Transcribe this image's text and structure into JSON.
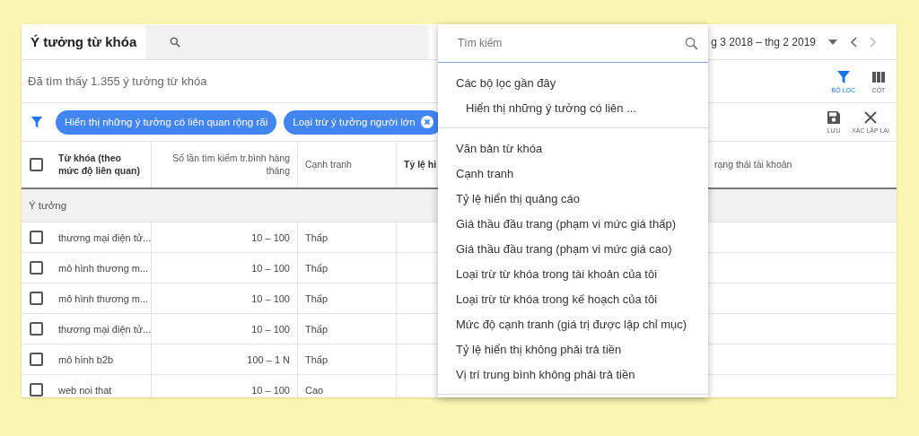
{
  "header": {
    "title": "Ý tưởng từ khóa",
    "date_range": "g 3 2018 – thg 2 2019"
  },
  "result_count": "Đã tìm thấy 1.355 ý tưởng từ khóa",
  "toolbar": [
    {
      "kind": "filter",
      "label": "BỘ LỌC",
      "selected": true
    },
    {
      "kind": "columns",
      "label": "CỘT",
      "selected": false
    }
  ],
  "actions": [
    {
      "kind": "save",
      "label": "LƯU"
    },
    {
      "kind": "reset",
      "label": "XÁC LẬP LẠI"
    }
  ],
  "chips": [
    {
      "label": "Hiển thị những ý tưởng có liên quan rộng rãi",
      "removable": false
    },
    {
      "label": "Loại trừ ý tưởng người lớn",
      "removable": true
    }
  ],
  "table": {
    "columns": [
      "Từ khóa (theo mức độ liên quan)",
      "Số lần tìm kiếm tr.bình hàng tháng",
      "Cạnh tranh",
      "Tỷ lệ hi",
      "rạng thái tài khoản"
    ],
    "group": "Ý tưởng",
    "select_all_checked": false,
    "rows": [
      {
        "keyword": "thương mại điện tử...",
        "searches": "10 – 100",
        "competition": "Thấp",
        "checked": false
      },
      {
        "keyword": "mô hình thương m...",
        "searches": "10 – 100",
        "competition": "Thấp",
        "checked": false
      },
      {
        "keyword": "mô hình thương m...",
        "searches": "10 – 100",
        "competition": "Thấp",
        "checked": false
      },
      {
        "keyword": "thương mại điện tử...",
        "searches": "10 – 100",
        "competition": "Thấp",
        "checked": false
      },
      {
        "keyword": "mô hình b2b",
        "searches": "100 – 1 N",
        "competition": "Thấp",
        "checked": false
      },
      {
        "keyword": "web noi that",
        "searches": "10 – 100",
        "competition": "Cao",
        "checked": false
      }
    ]
  },
  "filter_menu": {
    "search_placeholder": "Tìm kiếm",
    "recent_heading": "Các bộ lọc gần đây",
    "recent": [
      "Hiển thị những ý tưởng có liên ..."
    ],
    "fields": [
      "Văn bản từ khóa",
      "Cạnh tranh",
      "Tỷ lệ hiển thị quảng cáo",
      "Giá thầu đầu trang (phạm vi mức giá thấp)",
      "Giá thầu đầu trang (phạm vi mức giá cao)",
      "Loại trừ từ khóa trong tài khoản của tôi",
      "Loại trừ từ khóa trong kế hoạch của tôi",
      "Mức độ cạnh tranh (giá trị được lập chỉ mục)",
      "Tỷ lệ hiển thị không phải trả tiền",
      "Vị trí trung bình không phải trả tiền"
    ]
  }
}
